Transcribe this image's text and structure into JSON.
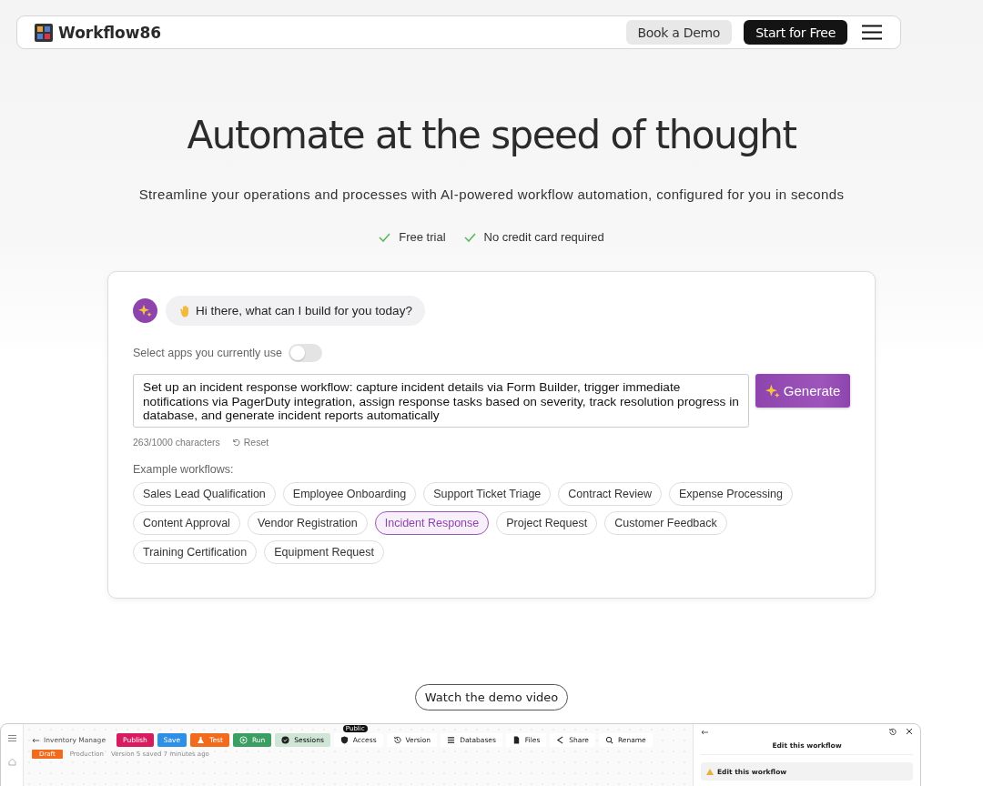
{
  "header": {
    "logo": "Workflow86",
    "buttons": [
      {
        "label": "Book a Demo",
        "kind": "secondary"
      },
      {
        "label": "Start for Free",
        "kind": "primary"
      }
    ]
  },
  "hero": {
    "title": "Automate at the speed of thought",
    "subtitle": "Streamline your operations and processes with AI-powered workflow automation, configured for you in seconds",
    "features": [
      "Free trial",
      "No credit card required"
    ]
  },
  "chat": {
    "greeting": "Hi there, what can I build for you today?",
    "apps_toggle": {
      "label": "Select apps you currently use",
      "on": false
    },
    "prompt": "Set up an incident response workflow: capture incident details via Form Builder, trigger immediate notifications via PagerDuty integration, assign response tasks based on severity, track resolution progress in database, and generate incident reports automatically",
    "generate_button": "Generate",
    "counter": "263/1000 characters",
    "reset": "Reset",
    "examples_label": "Example workflows:",
    "examples": [
      {
        "label": "Sales Lead Qualification",
        "selected": false
      },
      {
        "label": "Employee Onboarding",
        "selected": false
      },
      {
        "label": "Support Ticket Triage",
        "selected": false
      },
      {
        "label": "Contract Review",
        "selected": false
      },
      {
        "label": "Expense Processing",
        "selected": false
      },
      {
        "label": "Content Approval",
        "selected": false
      },
      {
        "label": "Vendor Registration",
        "selected": false
      },
      {
        "label": "Incident Response",
        "selected": true
      },
      {
        "label": "Project Request",
        "selected": false
      },
      {
        "label": "Customer Feedback",
        "selected": false
      },
      {
        "label": "Training Certification",
        "selected": false
      },
      {
        "label": "Equipment Request",
        "selected": false
      }
    ]
  },
  "demo": {
    "button": "Watch the demo video",
    "app": {
      "workflow_name": "Inventory Manage",
      "toolbar": [
        {
          "label": "Publish",
          "kind": "filled",
          "color": "#d81b60"
        },
        {
          "label": "Save",
          "kind": "filled",
          "color": "#2d8fe6"
        },
        {
          "label": "Test",
          "kind": "filled",
          "color": "#f26b1d"
        },
        {
          "label": "Run",
          "kind": "filled",
          "color": "#3b9f63"
        },
        {
          "label": "Sessions",
          "kind": "tinted",
          "color": "#cfe6d7"
        },
        {
          "label": "Access",
          "kind": "plain",
          "tooltip": "Public"
        },
        {
          "label": "Version",
          "kind": "plain"
        },
        {
          "label": "Databases",
          "kind": "plain"
        },
        {
          "label": "Files",
          "kind": "plain"
        },
        {
          "label": "Share",
          "kind": "plain"
        },
        {
          "label": "Rename",
          "kind": "plain"
        }
      ],
      "status": {
        "draft": "Draft",
        "environment": "Production",
        "saved": "Version 5 saved 7 minutes ago"
      },
      "panel": {
        "title": "Edit this workflow",
        "card": "Edit this workflow"
      }
    }
  }
}
